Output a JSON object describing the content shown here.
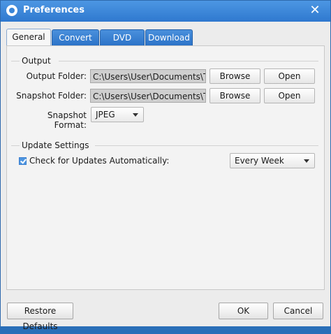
{
  "window": {
    "title": "Preferences",
    "close_glyph": "✕",
    "icon": "app-logo-icon"
  },
  "tabs": [
    {
      "label": "General",
      "active": true
    },
    {
      "label": "Convert",
      "active": false
    },
    {
      "label": "DVD",
      "active": false
    },
    {
      "label": "Download",
      "active": false
    }
  ],
  "output": {
    "section_title": "Output",
    "output_folder_label": "Output Folder:",
    "output_folder_value": "C:\\Users\\User\\Documents\\Tipard",
    "snapshot_folder_label": "Snapshot Folder:",
    "snapshot_folder_value": "C:\\Users\\User\\Documents\\Tipard",
    "browse_label": "Browse",
    "open_label": "Open",
    "snapshot_format_label": "Snapshot Format:",
    "snapshot_format_value": "JPEG"
  },
  "update": {
    "section_title": "Update Settings",
    "check_label": "Check for Updates Automatically:",
    "checked": true,
    "frequency_value": "Every Week"
  },
  "footer": {
    "restore_label": "Restore Defaults",
    "ok_label": "OK",
    "cancel_label": "Cancel"
  },
  "colors": {
    "titlebar": "#2f78cf",
    "tab": "#2c73c8"
  }
}
